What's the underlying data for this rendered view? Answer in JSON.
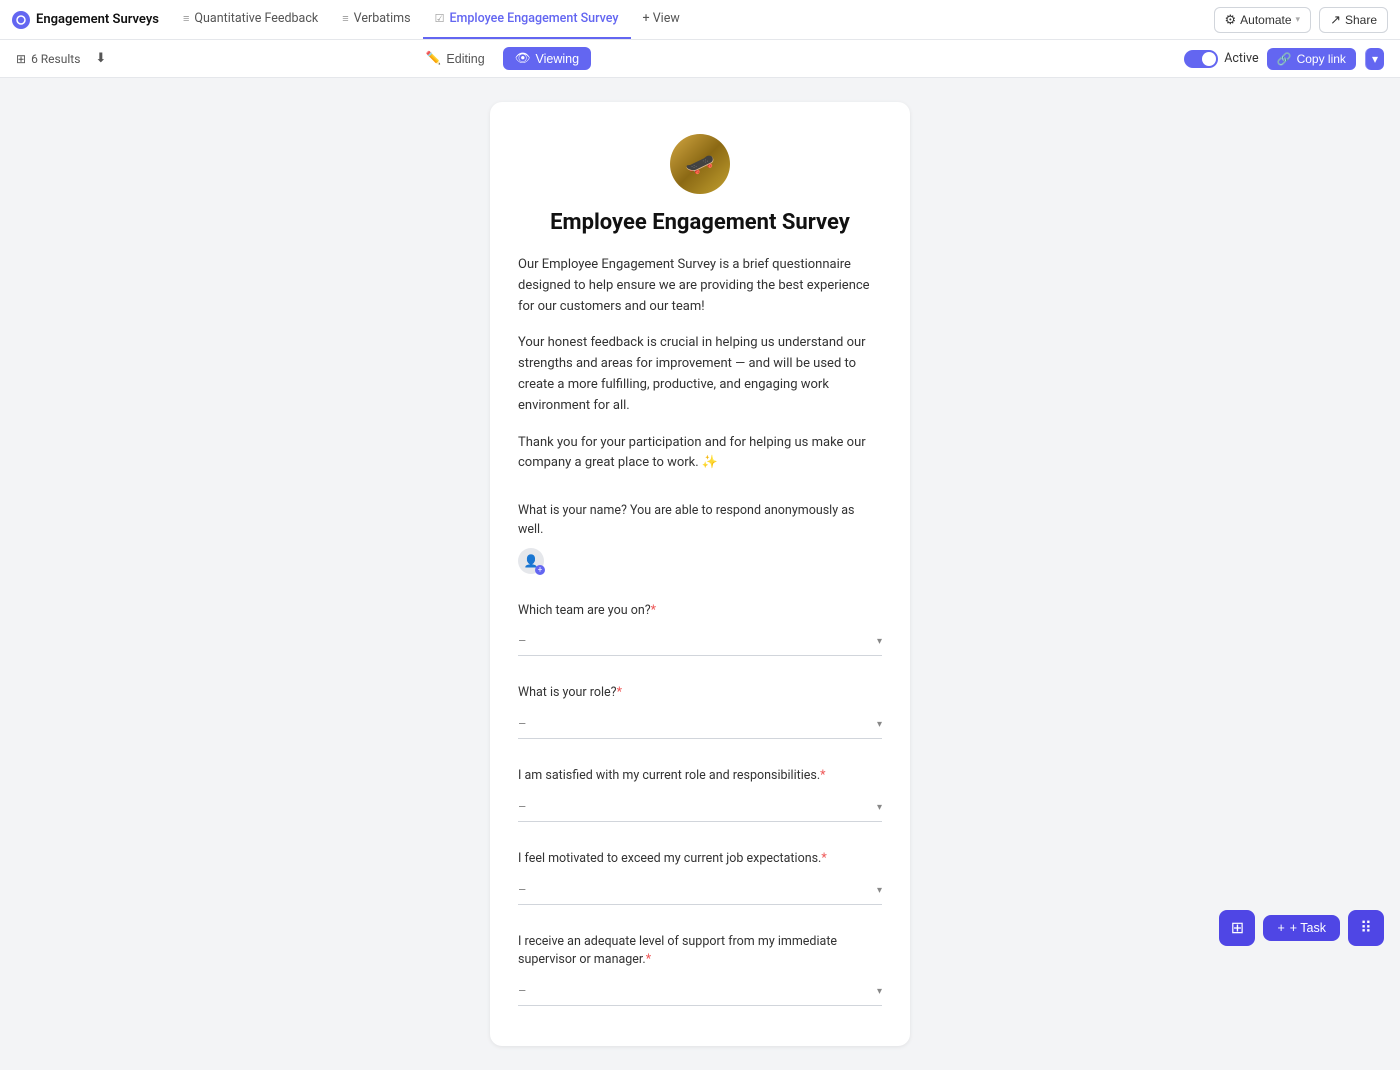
{
  "app": {
    "name": "Engagement Surveys"
  },
  "nav": {
    "tabs": [
      {
        "id": "quantitative",
        "label": "Quantitative Feedback",
        "icon": "≡",
        "active": false
      },
      {
        "id": "verbatims",
        "label": "Verbatims",
        "icon": "≡",
        "active": false
      },
      {
        "id": "survey",
        "label": "Employee Engagement Survey",
        "icon": "☑",
        "active": true
      },
      {
        "id": "view",
        "label": "+ View",
        "icon": "",
        "active": false
      }
    ],
    "automate_label": "Automate",
    "share_label": "Share"
  },
  "toolbar": {
    "results_count": "6 Results",
    "editing_label": "Editing",
    "viewing_label": "Viewing",
    "active_label": "Active",
    "copy_link_label": "Copy link"
  },
  "survey": {
    "title": "Employee Engagement Survey",
    "description_1": "Our Employee Engagement Survey is a brief questionnaire designed to help ensure we are providing the best experience for our customers and our team!",
    "description_2": "Your honest feedback is crucial in helping us understand our strengths and areas for improvement — and will be used to create a more fulfilling, productive, and engaging work environment for all.",
    "description_3": "Thank you for your participation and for helping us make our company a great place to work. ✨",
    "questions": [
      {
        "id": "name",
        "label": "What is your name? You are able to respond anonymously as well.",
        "type": "person",
        "required": false
      },
      {
        "id": "team",
        "label": "Which team are you on?",
        "type": "dropdown",
        "required": true,
        "placeholder": "–"
      },
      {
        "id": "role",
        "label": "What is your role?",
        "type": "dropdown",
        "required": true,
        "placeholder": "–"
      },
      {
        "id": "satisfied",
        "label": "I am satisfied with my current role and responsibilities.",
        "type": "dropdown",
        "required": true,
        "placeholder": "–"
      },
      {
        "id": "motivated",
        "label": "I feel motivated to exceed my current job expectations.",
        "type": "dropdown",
        "required": true,
        "placeholder": "–"
      },
      {
        "id": "support",
        "label": "I receive an adequate level of support from my immediate supervisor or manager.",
        "type": "dropdown",
        "required": true,
        "placeholder": "–"
      }
    ]
  },
  "bottom": {
    "task_label": "+ Task"
  }
}
